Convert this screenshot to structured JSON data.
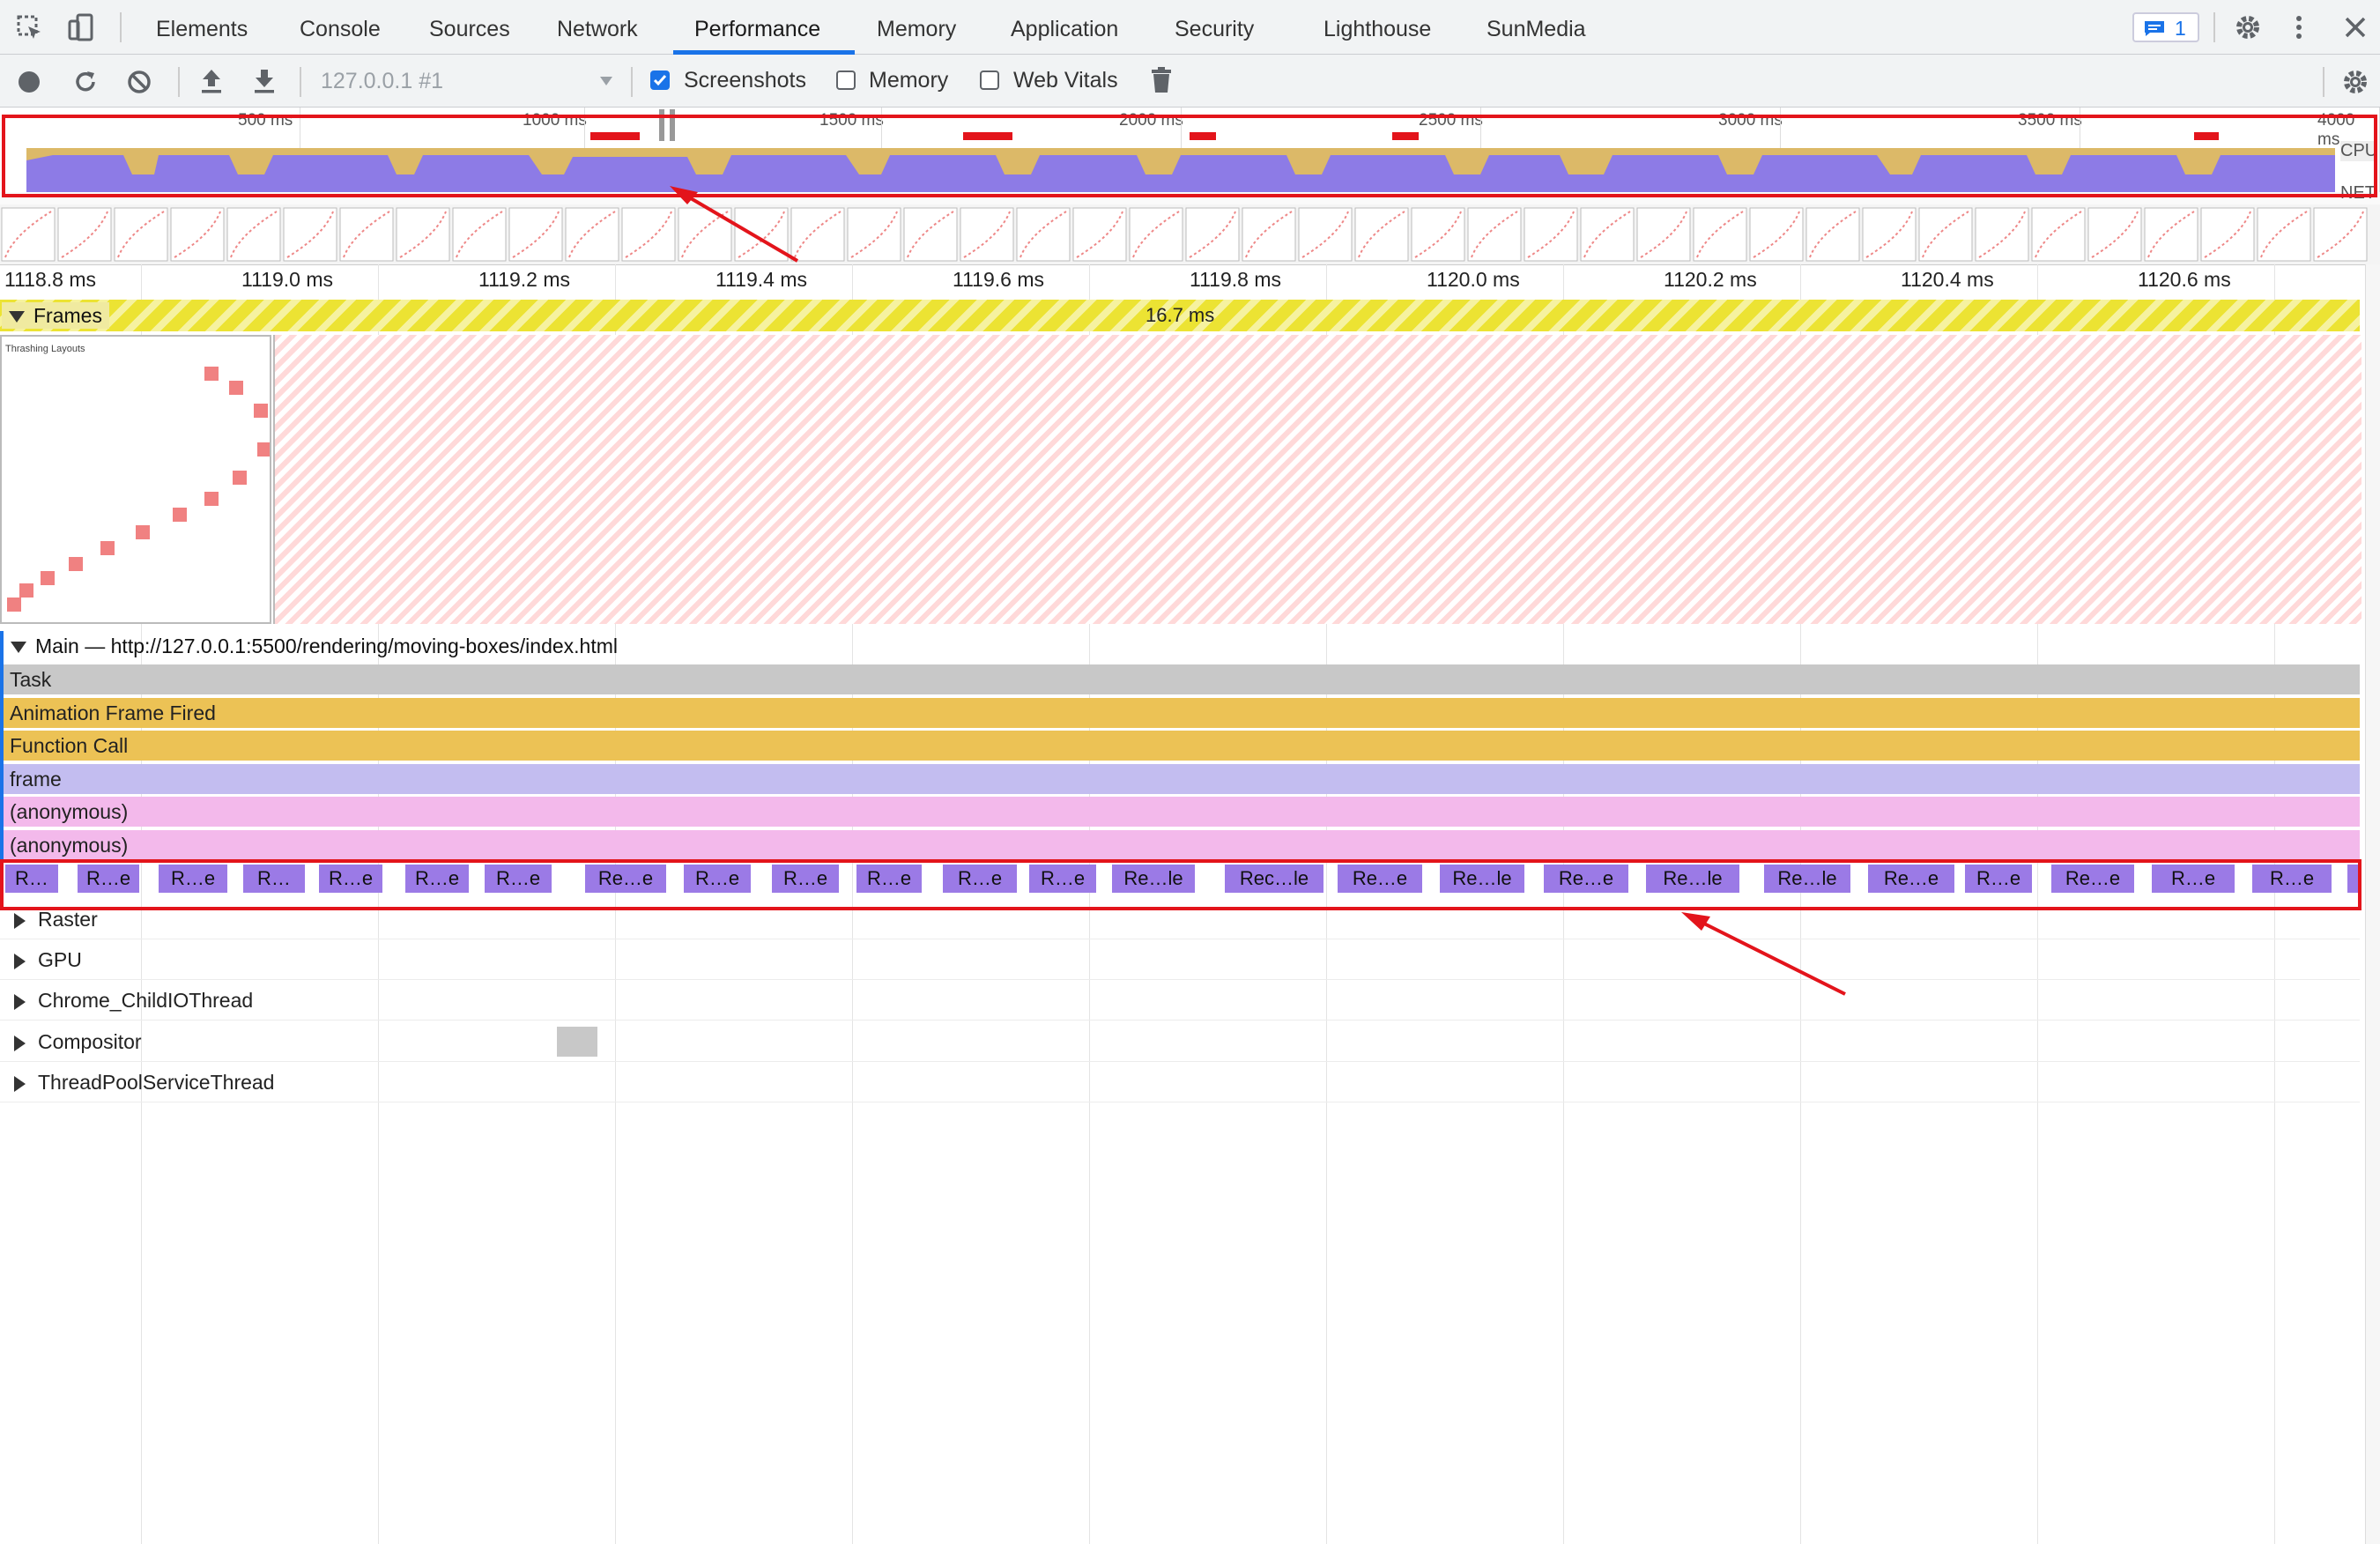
{
  "tabs": [
    {
      "label": "Elements"
    },
    {
      "label": "Console"
    },
    {
      "label": "Sources"
    },
    {
      "label": "Network"
    },
    {
      "label": "Performance",
      "active": true
    },
    {
      "label": "Memory"
    },
    {
      "label": "Application"
    },
    {
      "label": "Security"
    },
    {
      "label": "Lighthouse"
    },
    {
      "label": "SunMedia"
    }
  ],
  "issues_badge": "1",
  "toolbar": {
    "profile_select": "127.0.0.1 #1",
    "screenshots_label": "Screenshots",
    "screenshots_checked": true,
    "memory_label": "Memory",
    "memory_checked": false,
    "web_vitals_label": "Web Vitals",
    "web_vitals_checked": false
  },
  "overview": {
    "ruler": [
      "500 ms",
      "1000 ms",
      "1500 ms",
      "2000 ms",
      "2500 ms",
      "3000 ms",
      "3500 ms",
      "4000 ms"
    ],
    "cpu_label": "CPU",
    "net_label": "NET"
  },
  "timeline_ticks": [
    "1118.8 ms",
    "1119.0 ms",
    "1119.2 ms",
    "1119.4 ms",
    "1119.6 ms",
    "1119.8 ms",
    "1120.0 ms",
    "1120.2 ms",
    "1120.4 ms",
    "1120.6 ms"
  ],
  "frames": {
    "label": "Frames",
    "duration": "16.7 ms",
    "screenshot_title": "Thrashing Layouts"
  },
  "main_track": {
    "title": "Main — http://127.0.0.1:5500/rendering/moving-boxes/index.html",
    "rows": [
      {
        "label": "Task",
        "color": "#c8c8c8"
      },
      {
        "label": "Animation Frame Fired",
        "color": "#ecc255"
      },
      {
        "label": "Function Call",
        "color": "#ecc255"
      },
      {
        "label": "frame",
        "color": "#c3bdf0"
      },
      {
        "label": "(anonymous)",
        "color": "#f3b9eb"
      },
      {
        "label": "(anonymous)",
        "color": "#f3b9eb"
      }
    ],
    "leaf_color": "#9b7ae6",
    "leaves": [
      "R…",
      "R…e",
      "R…e",
      "R…",
      "R…e",
      "R…e",
      "R…e",
      "Re…e",
      "R…e",
      "R…e",
      "R…e",
      "R…e",
      "R…e",
      "Re…le",
      "Rec…le",
      "Re…e",
      "Re…le",
      "Re…e",
      "Re…le",
      "Re…le",
      "Re…e",
      "R…e",
      "Re…e",
      "R…e",
      "R…e"
    ]
  },
  "threads": [
    "Raster",
    "GPU",
    "Chrome_ChildIOThread",
    "Compositor",
    "ThreadPoolServiceThread"
  ],
  "annotation_color": "#e3141b"
}
